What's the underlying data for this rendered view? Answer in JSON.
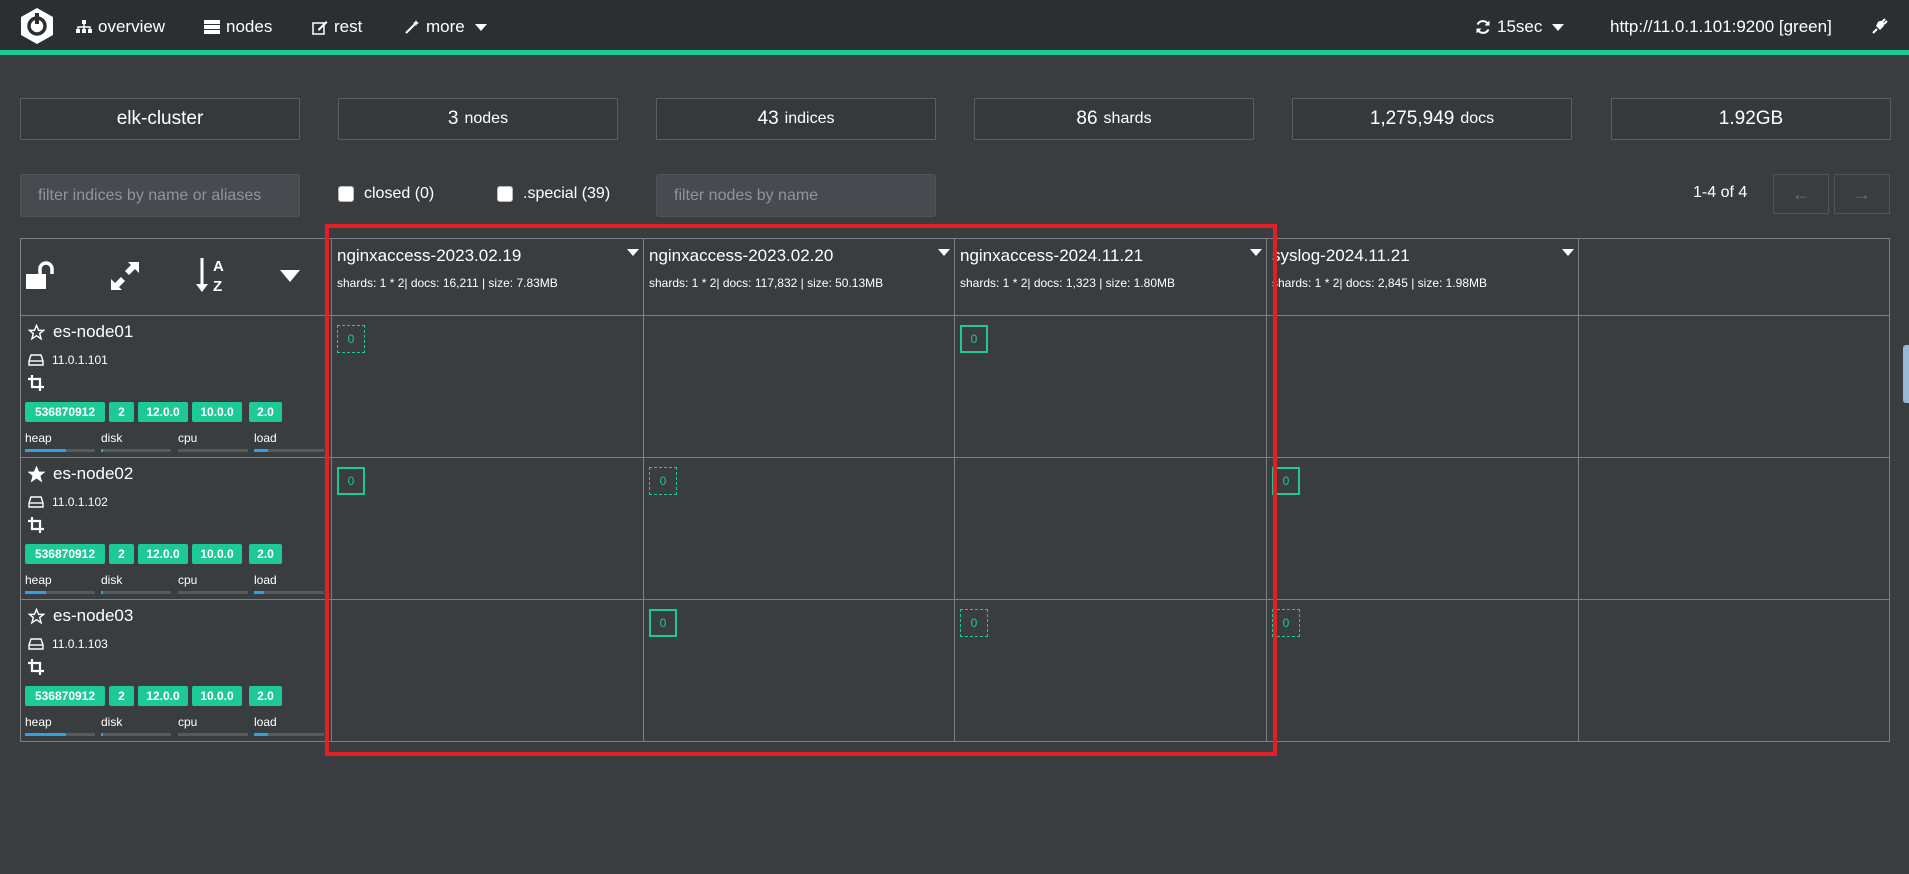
{
  "nav": {
    "overview": "overview",
    "nodes": "nodes",
    "rest": "rest",
    "more": "more",
    "refresh": "15sec",
    "connection": "http://11.0.1.101:9200 [green]"
  },
  "stats": {
    "cluster_name": "elk-cluster",
    "nodes_value": "3",
    "nodes_label": "nodes",
    "indices_value": "43",
    "indices_label": "indices",
    "shards_value": "86",
    "shards_label": "shards",
    "docs_value": "1,275,949",
    "docs_label": "docs",
    "size": "1.92GB"
  },
  "filters": {
    "indices_placeholder": "filter indices by name or aliases",
    "closed_label": "closed (0)",
    "special_label": ".special (39)",
    "nodes_placeholder": "filter nodes by name"
  },
  "pager": {
    "text": "1-4 of 4",
    "prev": "←",
    "next": "→"
  },
  "indices": [
    {
      "name": "nginxaccess-2023.02.19",
      "info": "shards: 1 * 2| docs: 16,211 | size: 7.83MB"
    },
    {
      "name": "nginxaccess-2023.02.20",
      "info": "shards: 1 * 2| docs: 117,832 | size: 50.13MB"
    },
    {
      "name": "nginxaccess-2024.11.21",
      "info": "shards: 1 * 2| docs: 1,323 | size: 1.80MB"
    },
    {
      "name": "syslog-2024.11.21",
      "info": "shards: 1 * 2| docs: 2,845 | size: 1.98MB"
    }
  ],
  "nodes": [
    {
      "name": "es-node01",
      "ip": "11.0.1.101",
      "master": false,
      "badges": [
        "536870912",
        "2",
        "12.0.0",
        "10.0.0",
        "2.0"
      ],
      "metrics": {
        "heap": 0.58,
        "disk": 0.03,
        "cpu": 0.0,
        "load": 0.2
      }
    },
    {
      "name": "es-node02",
      "ip": "11.0.1.102",
      "master": true,
      "badges": [
        "536870912",
        "2",
        "12.0.0",
        "10.0.0",
        "2.0"
      ],
      "metrics": {
        "heap": 0.3,
        "disk": 0.03,
        "cpu": 0.0,
        "load": 0.14
      }
    },
    {
      "name": "es-node03",
      "ip": "11.0.1.103",
      "master": false,
      "badges": [
        "536870912",
        "2",
        "12.0.0",
        "10.0.0",
        "2.0"
      ],
      "metrics": {
        "heap": 0.58,
        "disk": 0.03,
        "cpu": 0.0,
        "load": 0.2
      }
    }
  ],
  "metric_labels": {
    "heap": "heap",
    "disk": "disk",
    "cpu": "cpu",
    "load": "load"
  },
  "shard_number": "0",
  "colors": {
    "accent": "#1dc996",
    "highlight": "#e01f26",
    "metric_fill": "#2fa0e6"
  }
}
